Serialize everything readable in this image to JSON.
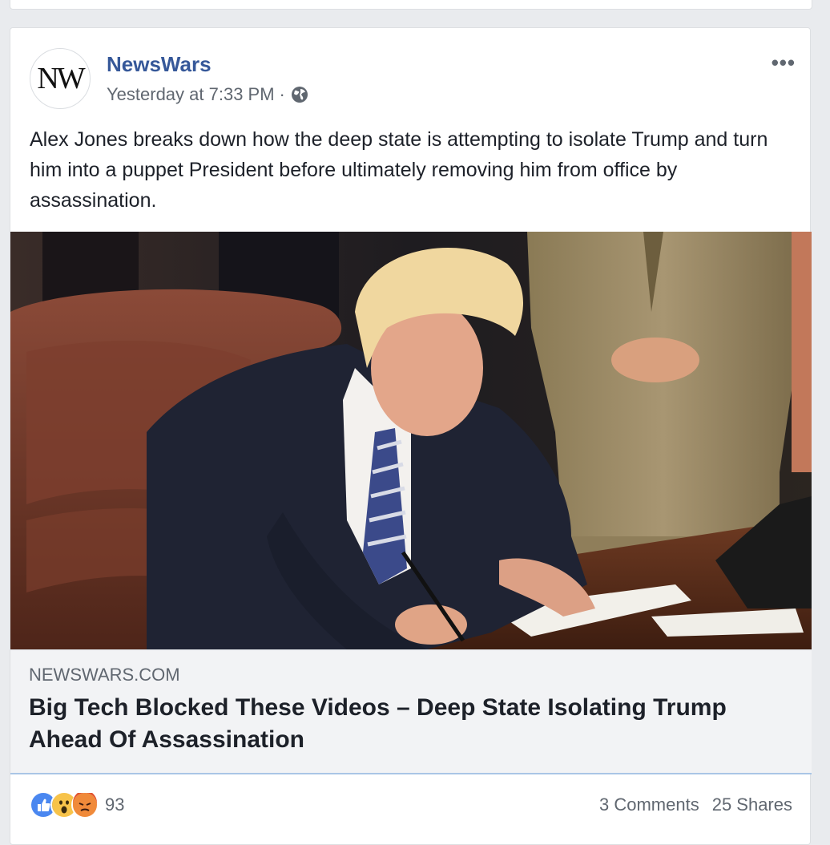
{
  "post": {
    "author": "NewsWars",
    "avatar_text": "NW",
    "timestamp": "Yesterday at 7:33 PM",
    "separator": "·",
    "privacy_icon": "globe-icon",
    "more_icon": "•••",
    "text": "Alex Jones breaks down how the deep state is attempting to isolate Trump and turn him into a puppet President before ultimately removing him from office by assassination."
  },
  "link": {
    "domain": "NEWSWARS.COM",
    "title": "Big Tech Blocked These Videos – Deep State Isolating Trump Ahead Of Assassination"
  },
  "footer": {
    "reactions": [
      "like-icon",
      "wow-icon",
      "angry-icon"
    ],
    "reaction_count": "93",
    "comments": "3 Comments",
    "shares": "25 Shares"
  },
  "colors": {
    "link_blue": "#365899",
    "like_blue": "#4a87f0",
    "wow_yellow": "#f7c34a",
    "angry_orange": "#e9713c"
  }
}
